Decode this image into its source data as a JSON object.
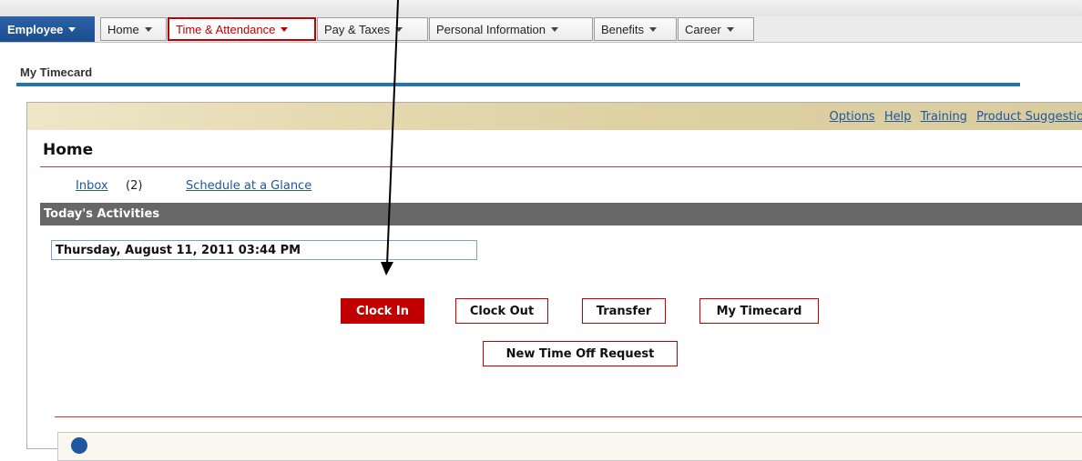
{
  "nav": {
    "employee_label": "Employee",
    "items": [
      {
        "label": "Home"
      },
      {
        "label": "Time & Attendance"
      },
      {
        "label": "Pay & Taxes"
      },
      {
        "label": "Personal Information"
      },
      {
        "label": "Benefits"
      },
      {
        "label": "Career"
      }
    ],
    "active_item": "Time & Attendance"
  },
  "page": {
    "title": "My Timecard"
  },
  "toolbar_links": [
    "Options",
    "Help",
    "Training",
    "Product Suggestio"
  ],
  "home": {
    "heading": "Home",
    "inbox_label": "Inbox",
    "inbox_count": "(2)",
    "schedule_label": "Schedule at a Glance"
  },
  "activities": {
    "header": "Today's Activities",
    "datetime": "Thursday, August 11, 2011 03:44 PM",
    "buttons": {
      "clock_in": "Clock In",
      "clock_out": "Clock Out",
      "transfer": "Transfer",
      "my_timecard": "My Timecard",
      "new_time_off": "New Time Off Request"
    }
  },
  "colors": {
    "accent_red": "#c00000",
    "nav_blue": "#1b4d8f",
    "rule_blue": "#1f74b6",
    "section_gray": "#676767",
    "link_blue": "#1f57a0"
  },
  "icons": {
    "dropdown": "chevron-down-icon",
    "info": "info-icon",
    "annotation": "pointer-arrow"
  }
}
